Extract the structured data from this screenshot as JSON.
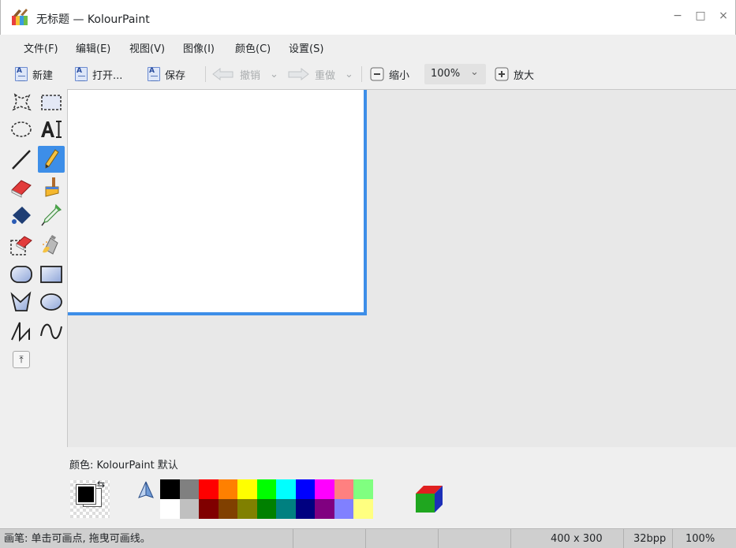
{
  "window": {
    "title": "无标题 — KolourPaint",
    "minimize_glyph": "−",
    "maximize_glyph": "□",
    "close_glyph": "×"
  },
  "menu": {
    "items": [
      "文件(F)",
      "编辑(E)",
      "视图(V)",
      "图像(I)",
      "颜色(C)",
      "设置(S)"
    ]
  },
  "toolbar": {
    "new_label": "新建",
    "open_label": "打开...",
    "save_label": "保存",
    "undo_label": "撤销",
    "redo_label": "重做",
    "zoom_out_label": "缩小",
    "zoom_value": "100%",
    "zoom_in_label": "放大",
    "dropdown_glyph": "⌄"
  },
  "tools": {
    "active": "pen",
    "extra_glyph": "⤒"
  },
  "color_panel": {
    "title": "颜色: KolourPaint 默认",
    "foreground": "#000000",
    "background": "#ffffff",
    "swap_glyph": "⇆",
    "palette_top": [
      "#000000",
      "#808080",
      "#ff0000",
      "#ff8000",
      "#ffff00",
      "#00ff00",
      "#00ffff",
      "#0000ff",
      "#ff00ff",
      "#ff8080",
      "#80ff80"
    ],
    "palette_bottom": [
      "#ffffff",
      "#c0c0c0",
      "#800000",
      "#804000",
      "#808000",
      "#008000",
      "#008080",
      "#000080",
      "#800080",
      "#8080ff",
      "#ffff80"
    ]
  },
  "status": {
    "message": "画笔: 单击可画点, 拖曳可画线。",
    "dimensions": "400 x 300",
    "depth": "32bpp",
    "zoom": "100%"
  },
  "accent_color": "#3d8ee8"
}
